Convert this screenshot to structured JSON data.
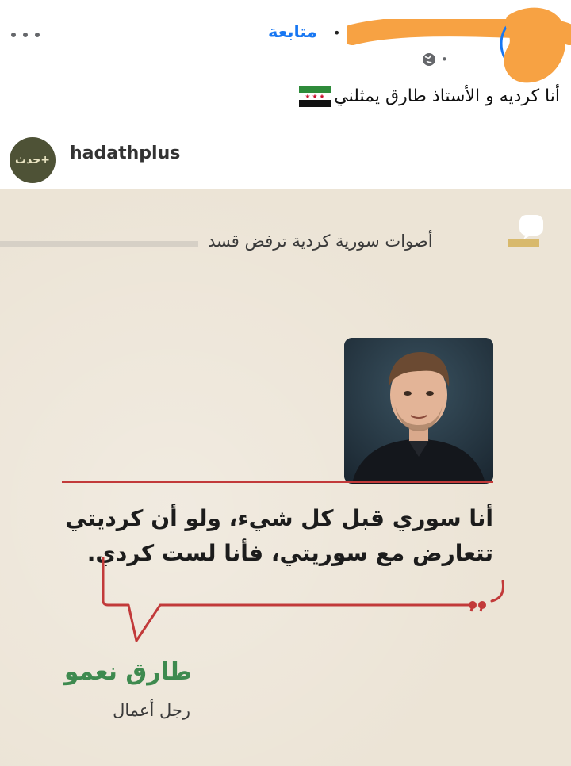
{
  "post": {
    "follow_label": "متابعة",
    "separator": "•",
    "meta_separator": "•",
    "caption": "أنا كرديه و الأستاذ طارق يمثلني"
  },
  "embedded_image": {
    "account_name": "hadathplus",
    "logo_text": "حدث+",
    "topic": "أصوات سورية كردية ترفض قسد",
    "quote_line_1": "أنا سوري قبل كل شيء، ولو أن كرديتي",
    "quote_line_2": "تتعارض مع سوريتي، فأنا لست كردي.",
    "author_name": "طارق نعمو",
    "author_title": "رجل أعمال"
  },
  "colors": {
    "accent_blue": "#1877f2",
    "quote_red": "#c23a3a",
    "name_green": "#3e8a4f",
    "card_bg": "#ece4d6",
    "redaction_orange": "#f7a243"
  },
  "icons": [
    "more-options-icon",
    "globe-icon",
    "syrian-flag-icon",
    "topic-speech-icon",
    "closing-quote-icon"
  ]
}
